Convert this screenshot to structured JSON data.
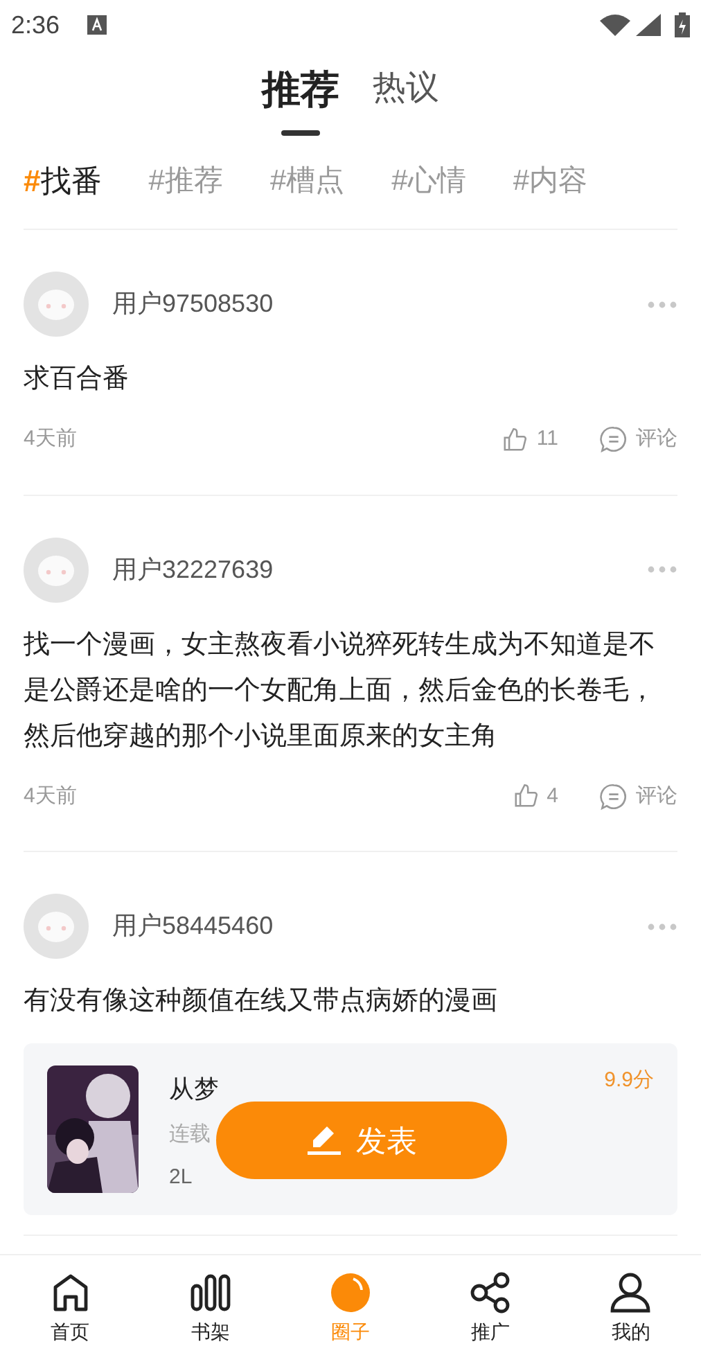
{
  "status_bar": {
    "time": "2:36"
  },
  "tabs": [
    {
      "label": "推荐",
      "selected": true
    },
    {
      "label": "热议",
      "selected": false
    }
  ],
  "topics": [
    {
      "hash": "#",
      "label": "找番",
      "selected": true
    },
    {
      "hash": "#",
      "label": "推荐",
      "selected": false
    },
    {
      "hash": "#",
      "label": "槽点",
      "selected": false
    },
    {
      "hash": "#",
      "label": "心情",
      "selected": false
    },
    {
      "hash": "#",
      "label": "内容",
      "selected": false
    }
  ],
  "posts": [
    {
      "user": "用户97508530",
      "text": "求百合番",
      "time": "4天前",
      "likes": "11",
      "comment": "评论"
    },
    {
      "user": "用户32227639",
      "text": "找一个漫画，女主熬夜看小说猝死转生成为不知道是不是公爵还是啥的一个女配角上面，然后金色的长卷毛，然后他穿越的那个小说里面原来的女主角",
      "time": "4天前",
      "likes": "4",
      "comment": "评论"
    },
    {
      "user": "用户58445460",
      "text": "有没有像这种颜值在线又带点病娇的漫画",
      "book": {
        "title": "从梦",
        "status": "连载",
        "floor": "2L",
        "score": "9.9分"
      }
    }
  ],
  "post_button": {
    "label": "发表"
  },
  "nav": [
    {
      "label": "首页",
      "selected": false
    },
    {
      "label": "书架",
      "selected": false
    },
    {
      "label": "圈子",
      "selected": true
    },
    {
      "label": "推广",
      "selected": false
    },
    {
      "label": "我的",
      "selected": false
    }
  ]
}
